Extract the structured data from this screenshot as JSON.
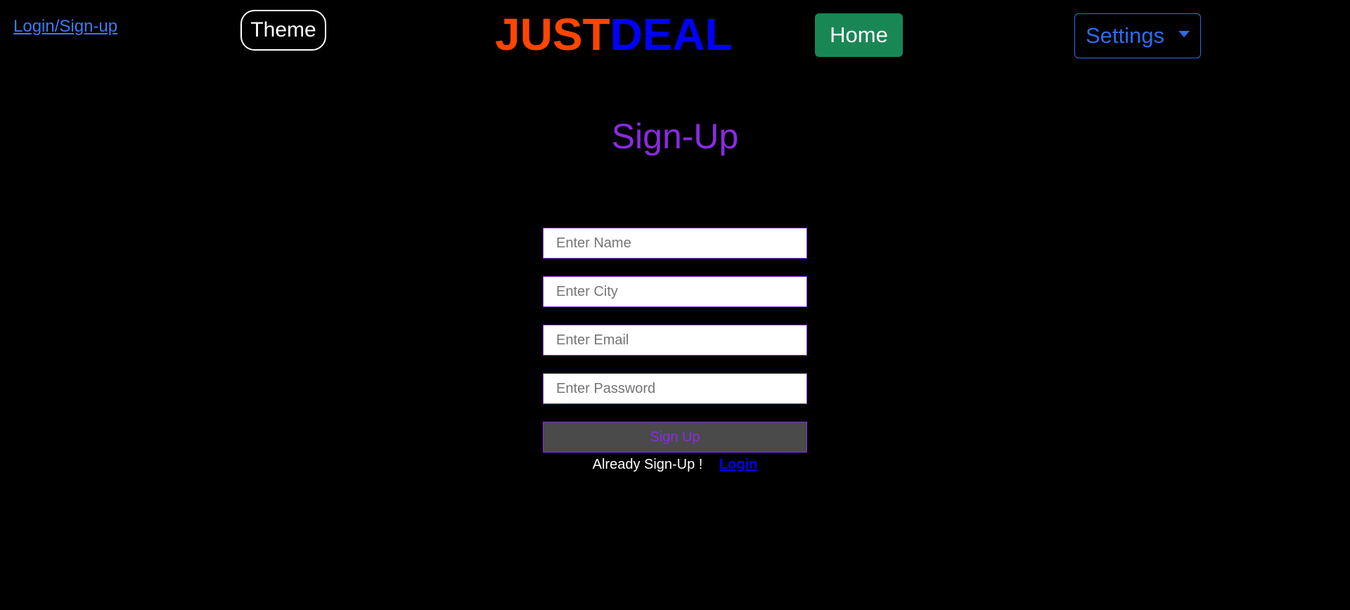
{
  "nav": {
    "login_link": "Login/Sign-up",
    "theme_button": "Theme",
    "brand": {
      "part1": "JUST",
      "part2": "DEAL"
    },
    "home_button": "Home",
    "settings_button": "Settings"
  },
  "signup": {
    "title": "Sign-Up",
    "fields": {
      "name_placeholder": "Enter Name",
      "city_placeholder": "Enter City",
      "email_placeholder": "Enter Email",
      "password_placeholder": "Enter Password"
    },
    "submit_label": "Sign Up",
    "already_text": "Already Sign-Up !",
    "login_link": "Login"
  },
  "colors": {
    "background": "#000000",
    "brand_just": "#ff4500",
    "brand_deal": "#0000ff",
    "accent_purple": "#8a2be2",
    "home_green": "#198754",
    "link_blue": "#3d7bf5"
  },
  "icons": {
    "settings_dropdown": "caret-down-icon"
  }
}
